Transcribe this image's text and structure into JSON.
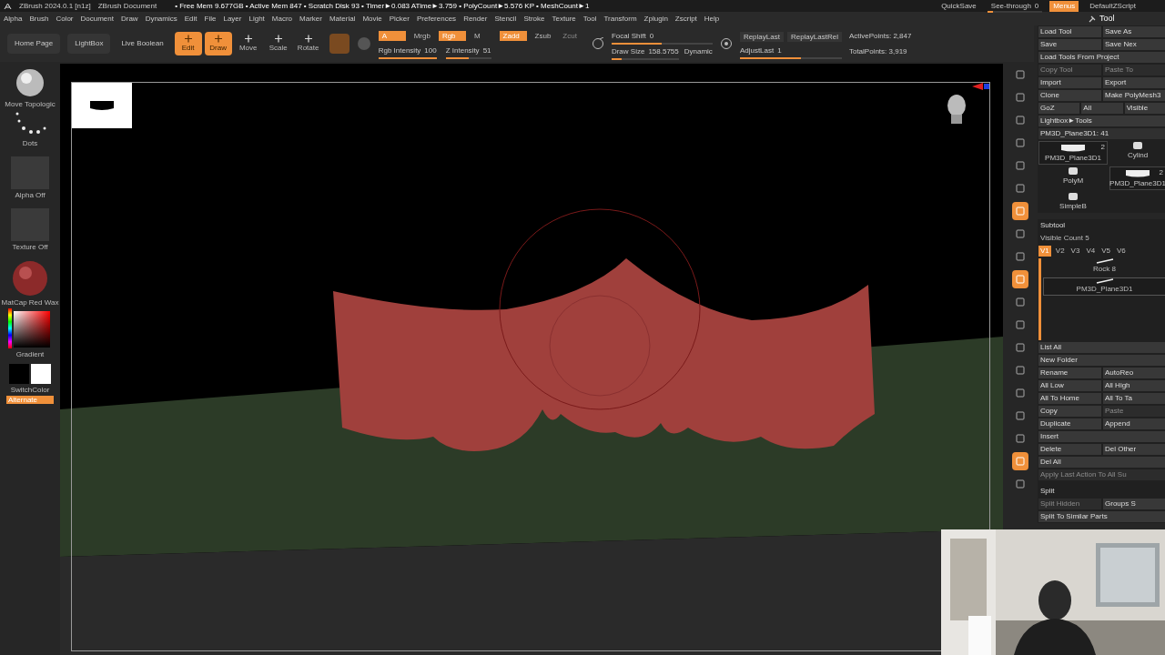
{
  "title_bar": {
    "app": "ZBrush 2024.0.1 [n1z]",
    "document": "ZBrush Document",
    "stats": "• Free Mem 9.677GB • Active Mem 847 • Scratch Disk 93 • Timer►0.083 ATime►3.759 • PolyCount►5.576 KP • MeshCount►1",
    "quicksave": "QuickSave",
    "see_through": {
      "label": "See-through",
      "value": "0",
      "level": 0.1
    },
    "menus": {
      "label": "Menus",
      "on": true
    },
    "script": "DefaultZScript"
  },
  "menu_bar": [
    "Alpha",
    "Brush",
    "Color",
    "Document",
    "Draw",
    "Dynamics",
    "Edit",
    "File",
    "Layer",
    "Light",
    "Macro",
    "Marker",
    "Material",
    "Movie",
    "Picker",
    "Preferences",
    "Render",
    "Stencil",
    "Stroke",
    "Texture",
    "Tool",
    "Transform",
    "Zplugin",
    "Zscript",
    "Help"
  ],
  "palette_title": "Tool",
  "toolbar": {
    "nav_buttons": [
      "Home Page",
      "LightBox",
      "Live Boolean"
    ],
    "modes": [
      {
        "label": "Edit",
        "selected": true
      },
      {
        "label": "Draw",
        "selected": true
      },
      {
        "label": "Move",
        "selected": false
      },
      {
        "label": "Scale",
        "selected": false
      },
      {
        "label": "Rotate",
        "selected": false
      }
    ],
    "channels": [
      {
        "label": "A",
        "selected": true
      },
      {
        "label": "Mrgb",
        "selected": false
      },
      {
        "label": "Rgb",
        "selected": true
      },
      {
        "label": "M",
        "selected": false
      }
    ],
    "depth": [
      {
        "label": "Zadd",
        "selected": true,
        "disabled": false
      },
      {
        "label": "Zsub",
        "selected": false,
        "disabled": false
      },
      {
        "label": "Zcut",
        "selected": false,
        "disabled": true
      }
    ],
    "intensity": [
      {
        "label": "Rgb Intensity",
        "value": "100",
        "level": 1
      },
      {
        "label": "Z Intensity",
        "value": "51",
        "level": 0.51
      }
    ],
    "focal_shift": {
      "label": "Focal Shift",
      "value": "0",
      "level": 0.5
    },
    "draw_size": {
      "label": "Draw Size",
      "value": "158.5755",
      "level": 0.15
    },
    "dynamic": "Dynamic",
    "replay": [
      "ReplayLast",
      "ReplayLastRel"
    ],
    "adjust_last": {
      "label": "AdjustLast",
      "value": "1",
      "level": 0.6
    },
    "stats": [
      "ActivePoints: 2,847",
      "TotalPoints: 3,919"
    ]
  },
  "left_shelf": [
    {
      "kind": "brush",
      "label": "Move Topologic"
    },
    {
      "kind": "stroke",
      "label": "Dots"
    },
    {
      "kind": "alpha",
      "label": "Alpha Off"
    },
    {
      "kind": "texture",
      "label": "Texture Off"
    },
    {
      "kind": "material",
      "label": "MatCap Red Wax"
    },
    {
      "kind": "color",
      "label": "Gradient"
    },
    {
      "kind": "swatches",
      "label": "SwitchColor"
    },
    {
      "kind": "toggle",
      "label": "Alternate",
      "on": true
    }
  ],
  "view_strip": [
    {
      "selected": false
    },
    {
      "selected": false
    },
    {
      "selected": false
    },
    {
      "selected": false
    },
    {
      "selected": false
    },
    {
      "selected": false
    },
    {
      "selected": true
    },
    {
      "selected": false
    },
    {
      "selected": false
    },
    {
      "selected": true
    },
    {
      "selected": false
    },
    {
      "selected": false
    },
    {
      "selected": false
    },
    {
      "selected": false
    },
    {
      "selected": false
    },
    {
      "selected": false
    },
    {
      "selected": false
    },
    {
      "selected": true
    },
    {
      "selected": false
    }
  ],
  "tool_palette": {
    "rows": [
      [
        {
          "label": "Load Tool",
          "disabled": false
        },
        {
          "label": "Save As",
          "disabled": false
        }
      ],
      [
        {
          "label": "Save",
          "disabled": false
        },
        {
          "label": "Save Nex",
          "disabled": false
        }
      ],
      [
        {
          "label": "Load Tools From Project",
          "disabled": false
        }
      ],
      [
        {
          "label": "Copy Tool",
          "disabled": true
        },
        {
          "label": "Paste To",
          "disabled": true
        }
      ],
      [
        {
          "label": "Import",
          "disabled": false
        },
        {
          "label": "Export",
          "disabled": false
        }
      ],
      [
        {
          "label": "Clone",
          "disabled": false
        },
        {
          "label": "Make PolyMesh3",
          "disabled": false
        }
      ],
      [
        {
          "label": "GoZ",
          "disabled": false
        },
        {
          "label": "All",
          "disabled": false
        },
        {
          "label": "Visible",
          "disabled": false
        }
      ],
      [
        {
          "label": "Lightbox►Tools",
          "disabled": false
        }
      ]
    ],
    "current_tool": "PM3D_Plane3D1: 41",
    "thumbnails": [
      {
        "label": "PM3D_Plane3D1",
        "count": "2"
      },
      {
        "label": "Cylind"
      },
      {
        "label": "PolyM"
      },
      {
        "label": "PM3D_Plane3D1",
        "count": "2"
      },
      {
        "label": "SimpleB"
      }
    ]
  },
  "subtool": {
    "title": "Subtool",
    "visible_count": "Visible Count 5",
    "versions": [
      {
        "label": "V1",
        "selected": true
      },
      {
        "label": "V2",
        "selected": false
      },
      {
        "label": "V3",
        "selected": false
      },
      {
        "label": "V4",
        "selected": false
      },
      {
        "label": "V5",
        "selected": false
      },
      {
        "label": "V6",
        "selected": false
      }
    ],
    "items": [
      {
        "label": "Rock 8",
        "selected": false
      },
      {
        "label": "PM3D_Plane3D1",
        "selected": true
      }
    ],
    "rows": [
      [
        {
          "label": "List All",
          "disabled": false
        }
      ],
      [
        {
          "label": "New Folder",
          "disabled": false
        }
      ],
      [
        {
          "label": "Rename",
          "disabled": false
        },
        {
          "label": "AutoReo",
          "disabled": false
        }
      ],
      [
        {
          "label": "All Low",
          "disabled": false
        },
        {
          "label": "All High",
          "disabled": false
        }
      ],
      [
        {
          "label": "All To Home",
          "disabled": false
        },
        {
          "label": "All To Ta",
          "disabled": false
        }
      ],
      [
        {
          "label": "Copy",
          "disabled": false
        },
        {
          "label": "Paste",
          "disabled": true
        }
      ],
      [
        {
          "label": "Duplicate",
          "disabled": false
        },
        {
          "label": "Append",
          "disabled": false
        }
      ],
      [
        {
          "label": "Insert",
          "disabled": false
        }
      ],
      [
        {
          "label": "Delete",
          "disabled": false
        },
        {
          "label": "Del Other",
          "disabled": false
        }
      ],
      [
        {
          "label": "Del All",
          "disabled": false
        }
      ],
      [
        {
          "label": "Apply Last Action To All Su",
          "disabled": true
        }
      ]
    ],
    "split_title": "Split",
    "split_rows": [
      [
        {
          "label": "Split Hidden",
          "disabled": true
        },
        {
          "label": "Groups S",
          "disabled": false
        }
      ],
      [
        {
          "label": "Split To Similar Parts",
          "disabled": false
        }
      ]
    ]
  }
}
